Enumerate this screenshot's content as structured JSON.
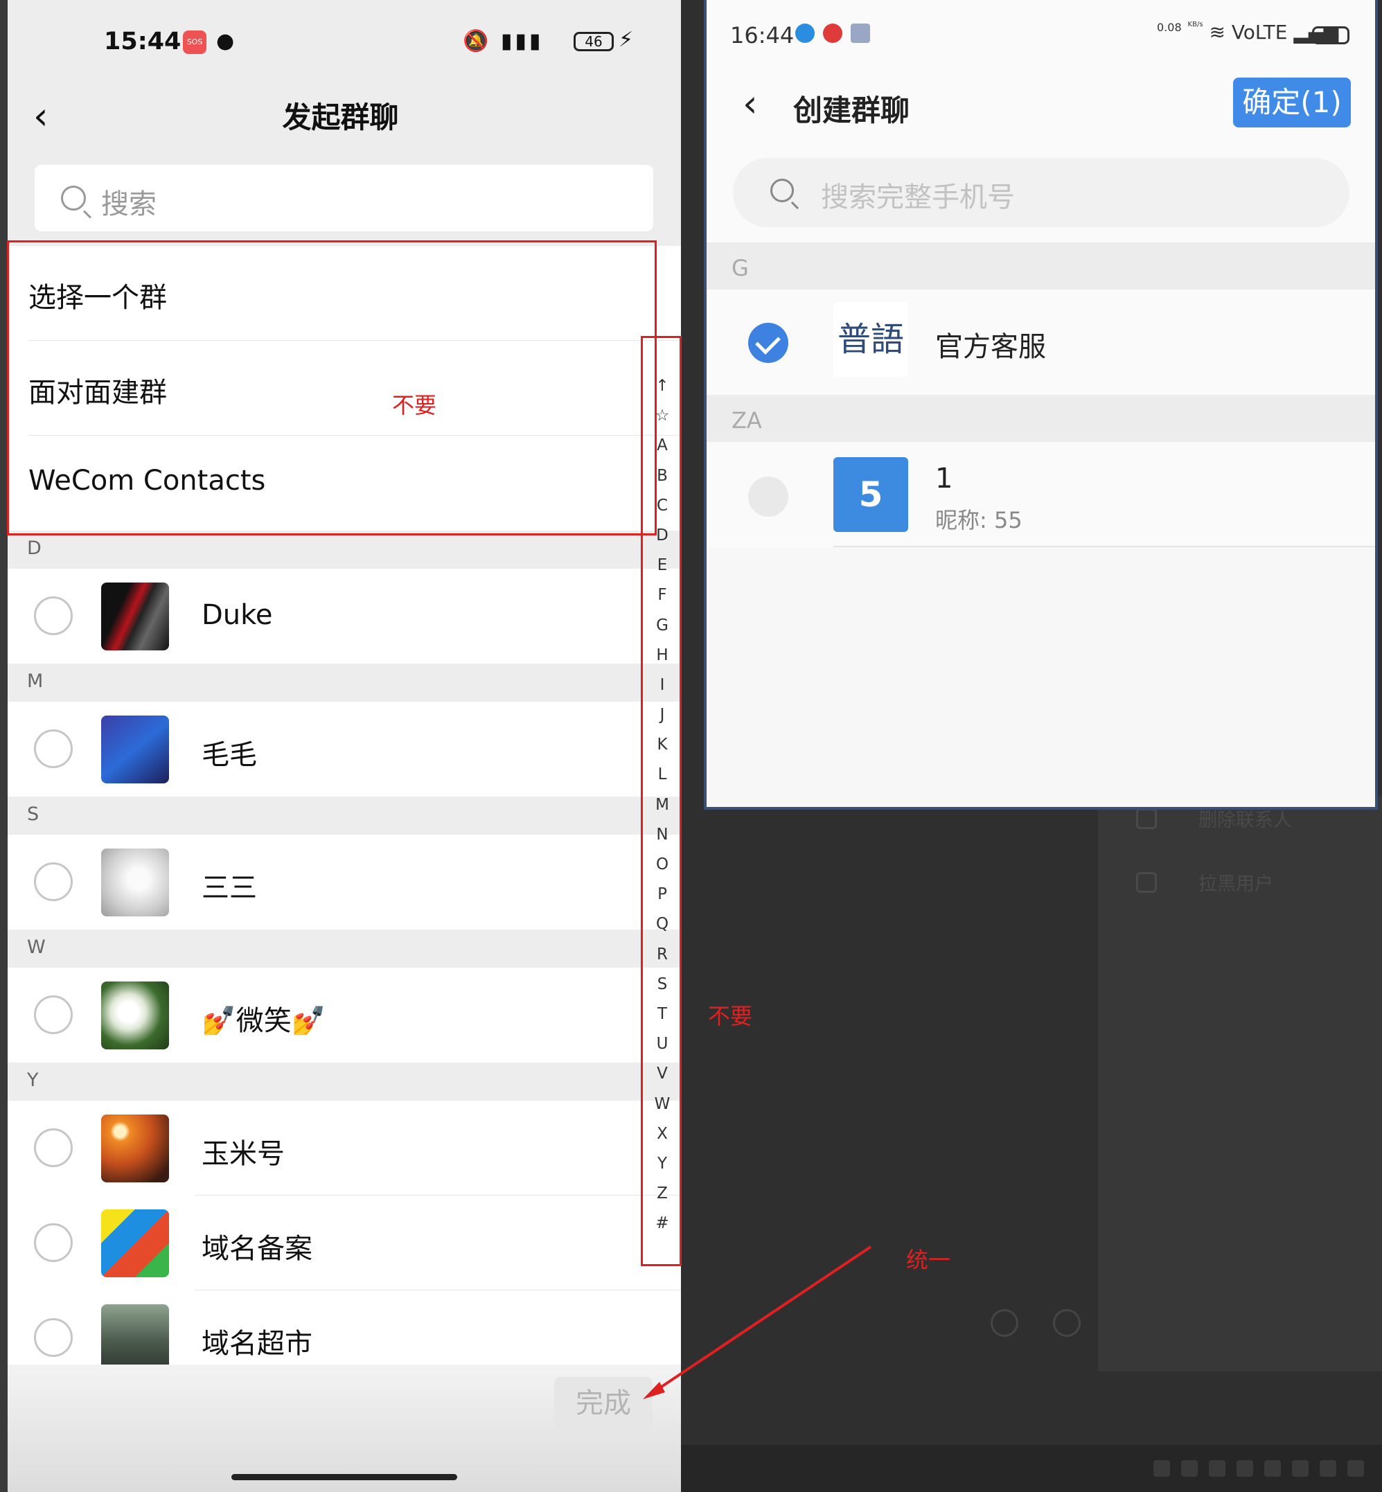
{
  "left_screen": {
    "status": {
      "time": "15:44",
      "sos": "SOS",
      "battery": "46"
    },
    "title": "发起群聊",
    "search_placeholder": "搜索",
    "options": [
      "选择一个群",
      "面对面建群",
      "WeCom Contacts"
    ],
    "sections": [
      {
        "letter": "D",
        "contacts": [
          "Duke"
        ]
      },
      {
        "letter": "M",
        "contacts": [
          "毛毛"
        ]
      },
      {
        "letter": "S",
        "contacts": [
          "三三"
        ]
      },
      {
        "letter": "W",
        "contacts": [
          "💅微笑💅"
        ]
      },
      {
        "letter": "Y",
        "contacts": [
          "玉米号",
          "域名备案",
          "域名超市"
        ]
      }
    ],
    "index": [
      "↑",
      "☆",
      "A",
      "B",
      "C",
      "D",
      "E",
      "F",
      "G",
      "H",
      "I",
      "J",
      "K",
      "L",
      "M",
      "N",
      "O",
      "P",
      "Q",
      "R",
      "S",
      "T",
      "U",
      "V",
      "W",
      "X",
      "Y",
      "Z",
      "#"
    ],
    "done_label": "完成"
  },
  "right_screen": {
    "status": {
      "time": "16:44",
      "net_speed": "0.08",
      "net_unit": "KB/s",
      "volte": "VoLTE",
      "battery": "40"
    },
    "title": "创建群聊",
    "confirm_label": "确定(1)",
    "search_placeholder": "搜索完整手机号",
    "sections": [
      {
        "letter": "G",
        "contact": {
          "logo_text": "普語",
          "name": "官方客服",
          "selected": true
        }
      },
      {
        "letter": "ZA",
        "contact": {
          "avatar_text": "5",
          "name": "1",
          "nickname": "昵称: 55",
          "selected": false
        }
      }
    ]
  },
  "background_app": {
    "menu_items": [
      "删除联系人",
      "拉黑用户"
    ]
  },
  "annotations": {
    "note1": "不要",
    "note2": "不要",
    "note3": "统一",
    "color": "#e02020"
  }
}
